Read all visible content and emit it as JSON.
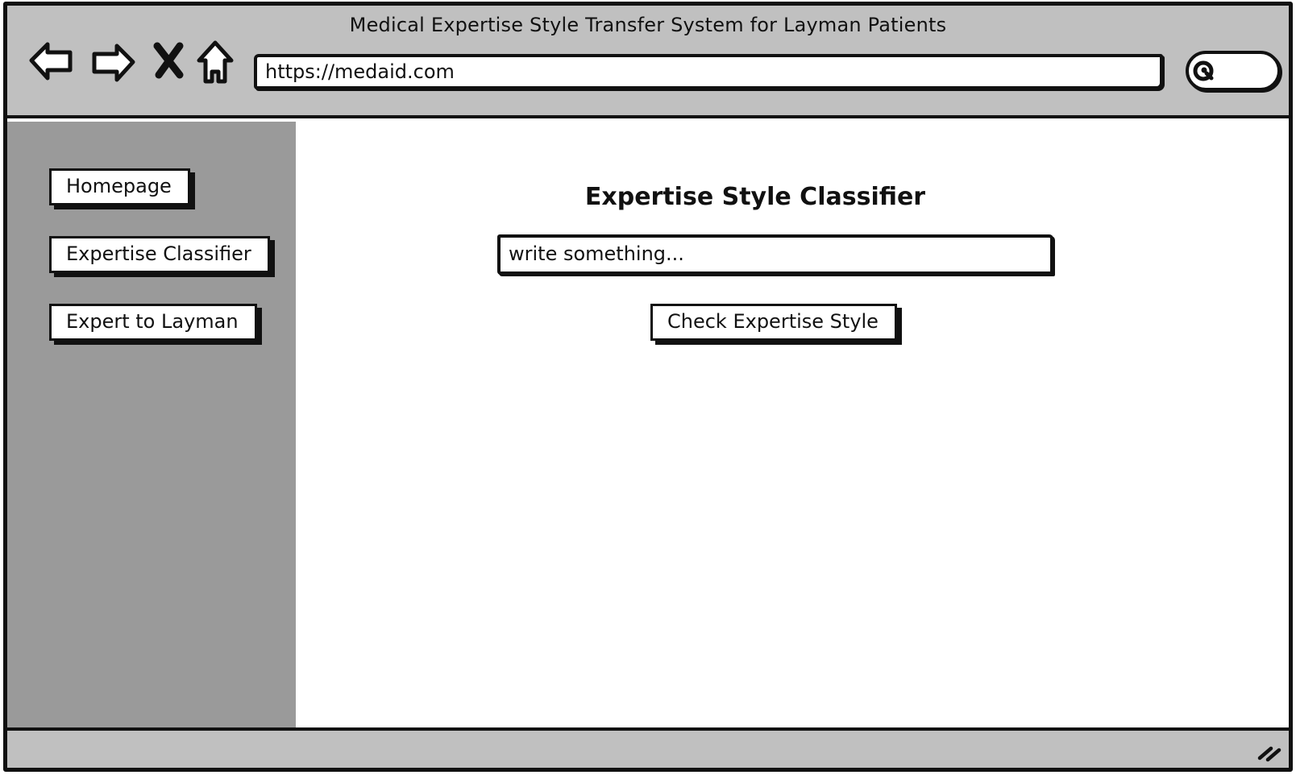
{
  "window": {
    "title": "Medical Expertise Style Transfer System for Layman Patients"
  },
  "browser": {
    "back_icon": "back-arrow-icon",
    "forward_icon": "forward-arrow-icon",
    "stop_icon": "close-x-icon",
    "home_icon": "home-icon",
    "url": "https://medaid.com",
    "search_icon": "search-icon"
  },
  "sidebar": {
    "items": [
      {
        "label": "Homepage"
      },
      {
        "label": "Expertise Classifier"
      },
      {
        "label": "Expert to Layman"
      }
    ]
  },
  "main": {
    "title": "Expertise Style Classifier",
    "input": {
      "value": "write something..."
    },
    "submit_label": "Check Expertise Style"
  },
  "colors": {
    "chrome_bg": "#c0c0c0",
    "sidebar_bg": "#9a9a9a",
    "content_bg": "#ffffff",
    "ink": "#111111"
  }
}
